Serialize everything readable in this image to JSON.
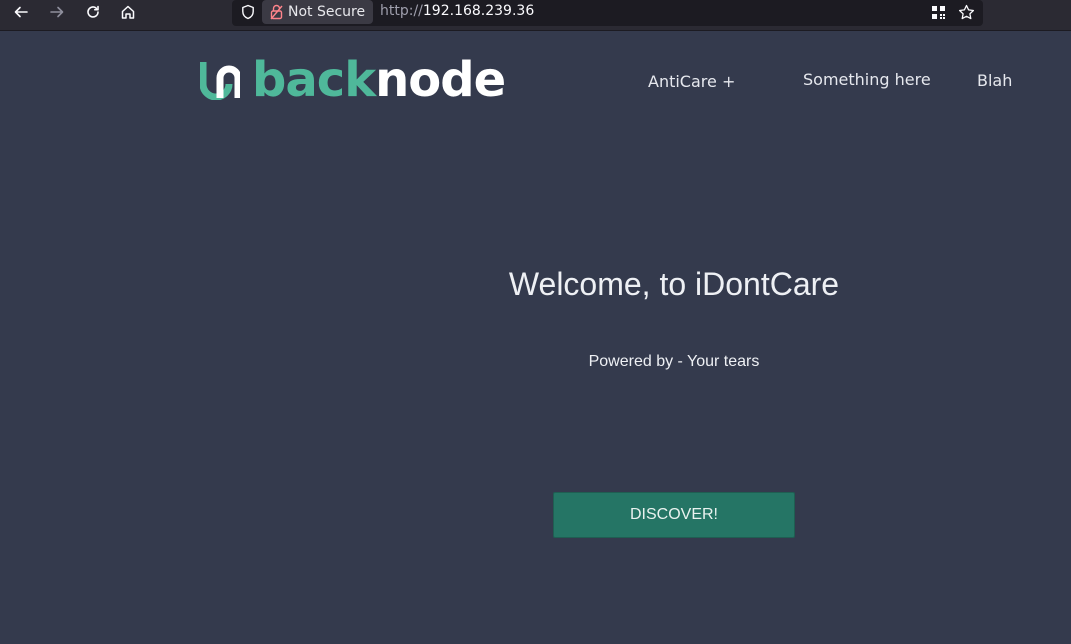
{
  "browser": {
    "security_label": "Not Secure",
    "url_scheme": "http://",
    "url_host": "192.168.239.36"
  },
  "site": {
    "logo": {
      "part1": "back",
      "part2": "node"
    },
    "nav": [
      {
        "label": "AntiCare +"
      },
      {
        "label": "Something here"
      },
      {
        "label": "Blah"
      }
    ],
    "hero": {
      "title": "Welcome, to iDontCare",
      "subtitle": "Powered by - Your tears",
      "cta_label": "DISCOVER!"
    }
  },
  "colors": {
    "page_background": "#343a4d",
    "accent_green": "#4fb89a",
    "button_background": "#257565"
  }
}
